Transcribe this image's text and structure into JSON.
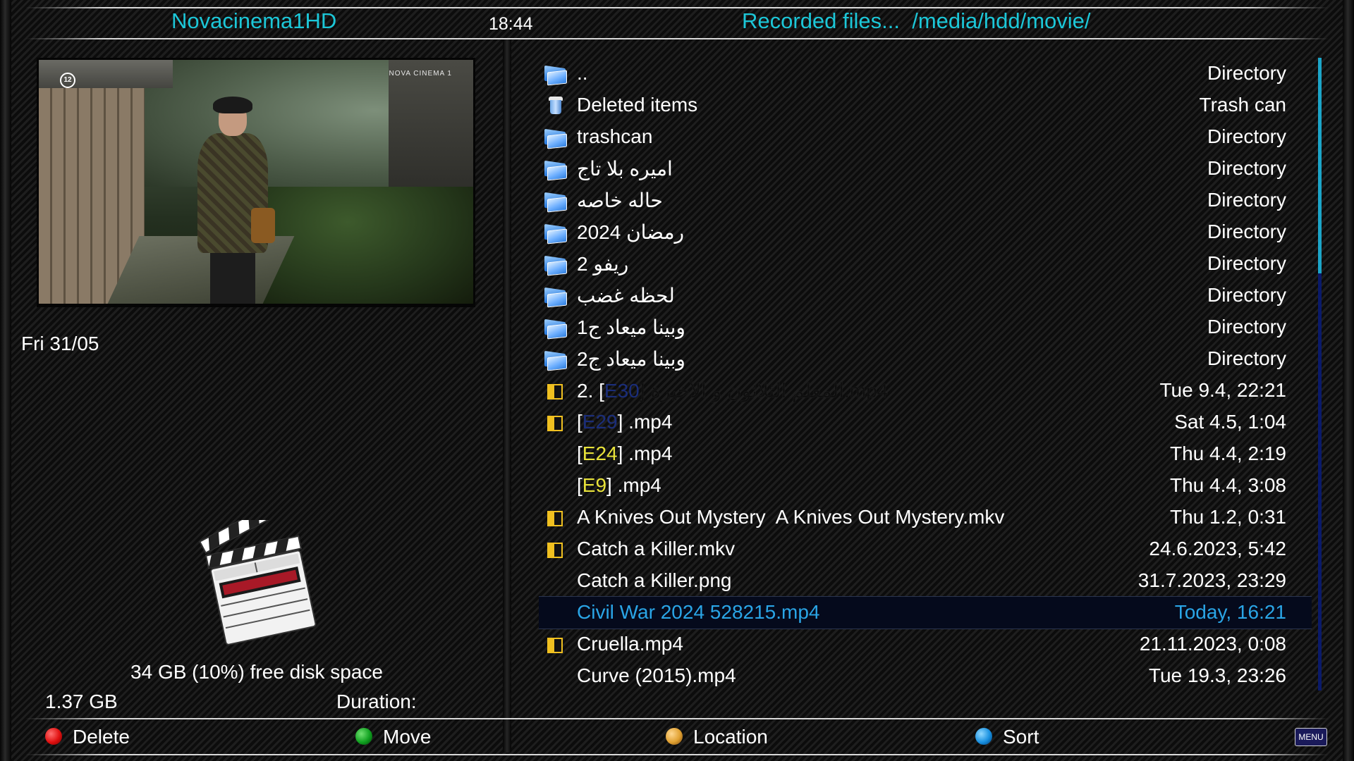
{
  "header": {
    "channel": "Novacinema1HD",
    "time": "18:44",
    "title": "Recorded files...  /media/hdd/movie/"
  },
  "preview": {
    "age_badge": "12",
    "channel_logo": "NOVA CINEMA 1"
  },
  "date": "Fri 31/05",
  "disk": {
    "free_space": "34 GB (10%) free disk space",
    "size": "1.37 GB",
    "duration_label": "Duration:"
  },
  "files": [
    {
      "icon": "folder-icon",
      "name": "..",
      "info": "Directory"
    },
    {
      "icon": "trash-icon",
      "name": "Deleted items",
      "info": "Trash can"
    },
    {
      "icon": "folder-icon",
      "name": "trashcan",
      "info": "Directory"
    },
    {
      "icon": "folder-icon",
      "name": "اميره بلا تاج",
      "info": "Directory"
    },
    {
      "icon": "folder-icon",
      "name": "حاله خاصه",
      "info": "Directory"
    },
    {
      "icon": "folder-icon",
      "name": "رمضان 2024",
      "info": "Directory"
    },
    {
      "icon": "folder-icon",
      "name": "ريفو 2",
      "info": "Directory"
    },
    {
      "icon": "folder-icon",
      "name": "لحظه غضب",
      "info": "Directory"
    },
    {
      "icon": "folder-icon",
      "name": "وبينا ميعاد ج1",
      "info": "Directory"
    },
    {
      "icon": "folder-icon",
      "name": "وبينا ميعاد ج2",
      "info": "Directory"
    },
    {
      "icon": "partially-watched-icon",
      "name_prefix": "2. [",
      "episode": "E30",
      "name_suffix": "] المعلم الثلاثون و الأخيرة.mp4",
      "info": "Tue 9.4, 22:21"
    },
    {
      "icon": "partially-watched-icon",
      "name_prefix": "[",
      "episode": "E29",
      "name_suffix": "] .mp4",
      "info": "Sat 4.5, 1:04"
    },
    {
      "icon": "",
      "name_prefix": "[",
      "episode": "E24",
      "name_suffix": "] .mp4",
      "info": "Thu 4.4, 2:19"
    },
    {
      "icon": "",
      "name_prefix": "[",
      "episode": "E9",
      "name_suffix": "] .mp4",
      "info": "Thu 4.4, 3:08"
    },
    {
      "icon": "partially-watched-icon",
      "name": "A Knives Out Mystery  A Knives Out Mystery.mkv",
      "info": "Thu 1.2, 0:31"
    },
    {
      "icon": "partially-watched-icon",
      "name": "Catch a Killer.mkv",
      "info": "24.6.2023, 5:42"
    },
    {
      "icon": "",
      "name": "Catch a Killer.png",
      "info": "31.7.2023, 23:29"
    },
    {
      "icon": "",
      "name": "Civil War 2024 528215.mp4",
      "info": "Today, 16:21",
      "selected": true
    },
    {
      "icon": "partially-watched-icon",
      "name": "Cruella.mp4",
      "info": "21.11.2023, 0:08"
    },
    {
      "icon": "",
      "name": "Curve (2015).mp4",
      "info": "Tue 19.3, 23:26"
    }
  ],
  "footer": {
    "red_label": "Delete",
    "green_label": "Move",
    "yellow_label": "Location",
    "blue_label": "Sort",
    "menu_label": "MENU",
    "colors": {
      "red": "#e01010",
      "green": "#10a020",
      "yellow": "#e0a030",
      "blue": "#1890e0"
    }
  },
  "colors": {
    "accent": "#1cc7d8",
    "selected_text": "#2aa5e6",
    "episode": "#e8e23a"
  }
}
